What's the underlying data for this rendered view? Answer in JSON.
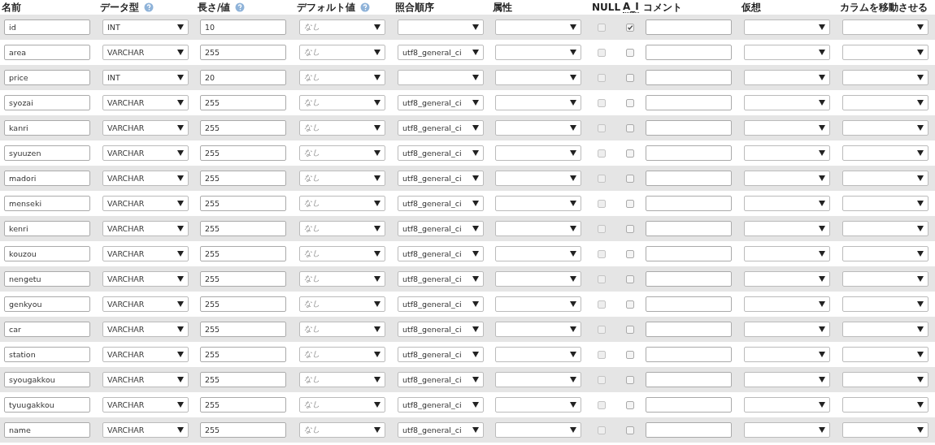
{
  "headers": [
    {
      "label": "名前"
    },
    {
      "label": "データ型",
      "help": true
    },
    {
      "label": "長さ/値",
      "help": true
    },
    {
      "label": "デフォルト値",
      "help": true
    },
    {
      "label": "照合順序"
    },
    {
      "label": "属性"
    },
    {
      "label": "NULL"
    },
    {
      "label": "A_I",
      "abbr": true
    },
    {
      "label": "コメント"
    },
    {
      "label": "仮想"
    },
    {
      "label": "カラムを移動させる"
    }
  ],
  "rows": [
    {
      "name": "id",
      "type": "INT",
      "length": "10",
      "default": "なし",
      "collation": "",
      "null": false,
      "ai": true
    },
    {
      "name": "area",
      "type": "VARCHAR",
      "length": "255",
      "default": "なし",
      "collation": "utf8_general_ci",
      "null": false,
      "ai": false
    },
    {
      "name": "price",
      "type": "INT",
      "length": "20",
      "default": "なし",
      "collation": "",
      "null": false,
      "ai": false
    },
    {
      "name": "syozai",
      "type": "VARCHAR",
      "length": "255",
      "default": "なし",
      "collation": "utf8_general_ci",
      "null": false,
      "ai": false
    },
    {
      "name": "kanri",
      "type": "VARCHAR",
      "length": "255",
      "default": "なし",
      "collation": "utf8_general_ci",
      "null": false,
      "ai": false
    },
    {
      "name": "syuuzen",
      "type": "VARCHAR",
      "length": "255",
      "default": "なし",
      "collation": "utf8_general_ci",
      "null": false,
      "ai": false
    },
    {
      "name": "madori",
      "type": "VARCHAR",
      "length": "255",
      "default": "なし",
      "collation": "utf8_general_ci",
      "null": false,
      "ai": false
    },
    {
      "name": "menseki",
      "type": "VARCHAR",
      "length": "255",
      "default": "なし",
      "collation": "utf8_general_ci",
      "null": false,
      "ai": false
    },
    {
      "name": "kenri",
      "type": "VARCHAR",
      "length": "255",
      "default": "なし",
      "collation": "utf8_general_ci",
      "null": false,
      "ai": false
    },
    {
      "name": "kouzou",
      "type": "VARCHAR",
      "length": "255",
      "default": "なし",
      "collation": "utf8_general_ci",
      "null": false,
      "ai": false
    },
    {
      "name": "nengetu",
      "type": "VARCHAR",
      "length": "255",
      "default": "なし",
      "collation": "utf8_general_ci",
      "null": false,
      "ai": false
    },
    {
      "name": "genkyou",
      "type": "VARCHAR",
      "length": "255",
      "default": "なし",
      "collation": "utf8_general_ci",
      "null": false,
      "ai": false
    },
    {
      "name": "car",
      "type": "VARCHAR",
      "length": "255",
      "default": "なし",
      "collation": "utf8_general_ci",
      "null": false,
      "ai": false
    },
    {
      "name": "station",
      "type": "VARCHAR",
      "length": "255",
      "default": "なし",
      "collation": "utf8_general_ci",
      "null": false,
      "ai": false
    },
    {
      "name": "syougakkou",
      "type": "VARCHAR",
      "length": "255",
      "default": "なし",
      "collation": "utf8_general_ci",
      "null": false,
      "ai": false
    },
    {
      "name": "tyuugakkou",
      "type": "VARCHAR",
      "length": "255",
      "default": "なし",
      "collation": "utf8_general_ci",
      "null": false,
      "ai": false
    },
    {
      "name": "name",
      "type": "VARCHAR",
      "length": "255",
      "default": "なし",
      "collation": "utf8_general_ci",
      "null": false,
      "ai": false
    }
  ]
}
